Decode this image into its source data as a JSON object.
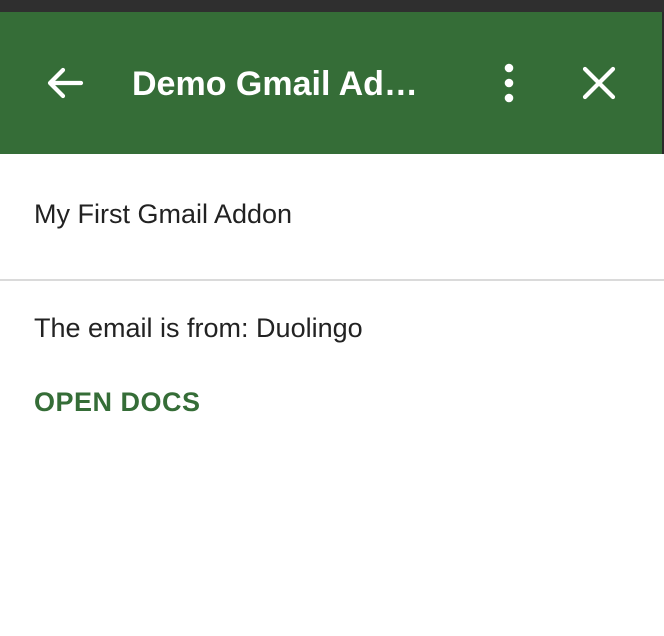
{
  "colors": {
    "accent": "#356d37",
    "header_text": "#ffffff",
    "body_text": "#222222"
  },
  "header": {
    "title": "Demo Gmail Ad…",
    "back_icon": "arrow-left-icon",
    "more_icon": "more-vert-icon",
    "close_icon": "close-icon"
  },
  "card": {
    "header_text": "My First Gmail Addon",
    "body_text": "The email is from: Duolingo",
    "action_label": "OPEN DOCS"
  }
}
